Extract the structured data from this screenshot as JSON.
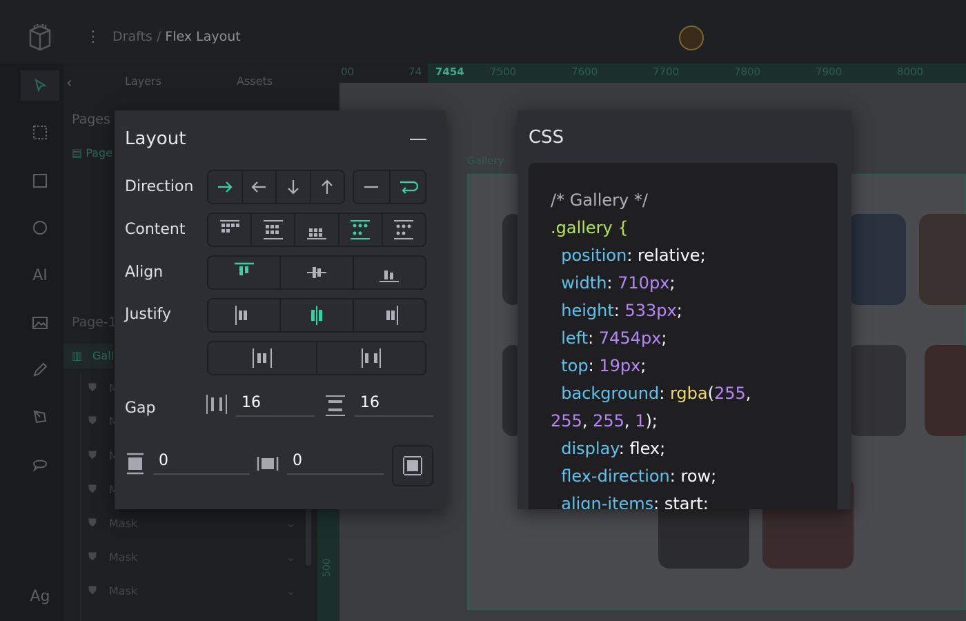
{
  "breadcrumb": {
    "parent": "Drafts",
    "separator": " / ",
    "current": "Flex Layout"
  },
  "sidebar": {
    "tabs": [
      {
        "label": "Layers"
      },
      {
        "label": "Assets"
      }
    ],
    "pages_label": "Pages",
    "page_item": "Page",
    "page1_label": "Page-1",
    "gallery_item": "Gall",
    "mask_items": [
      "M",
      "M",
      "M",
      "M",
      "Mask",
      "Mask",
      "Mask"
    ]
  },
  "toolrail": {
    "text_tool": "AI",
    "font_tool": "Ag"
  },
  "ruler": {
    "marks": [
      "00",
      "74",
      "7454",
      "7500",
      "7600",
      "7700",
      "7800",
      "7900",
      "8000"
    ],
    "side_mark": "500"
  },
  "canvas": {
    "frame_label": "Gallery"
  },
  "layout_panel": {
    "title": "Layout",
    "direction_label": "Direction",
    "content_label": "Content",
    "align_label": "Align",
    "justify_label": "Justify",
    "gap_label": "Gap",
    "gap_row": "16",
    "gap_column": "16",
    "padding_vertical": "0",
    "padding_horizontal": "0"
  },
  "css_panel": {
    "title": "CSS",
    "lines": [
      "/* Gallery */",
      ".gallery {",
      "position",
      "relative",
      "width",
      "710px",
      "height",
      "533px",
      "left",
      "7454px",
      "top",
      "19px",
      "background",
      "rgba",
      "255",
      "255",
      "255",
      "1",
      "display",
      "flex",
      "flex-direction",
      "row",
      "align-items",
      "start"
    ]
  },
  "colors": {
    "accent": "#2fd6a3",
    "panel": "#2d2e33",
    "code_bg": "#1f1f21"
  }
}
